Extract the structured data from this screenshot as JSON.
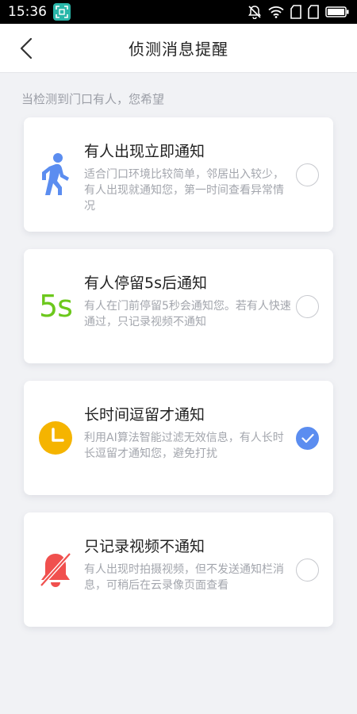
{
  "status_bar": {
    "time": "15:36"
  },
  "nav": {
    "title": "侦测消息提醒"
  },
  "section_hint": "当检测到门口有人，您希望",
  "options": [
    {
      "title": "有人出现立即通知",
      "description": "适合门口环境比较简单，邻居出入较少，有人出现就通知您，第一时间查看异常情况",
      "icon": "walking-person-icon",
      "selected": false
    },
    {
      "title": "有人停留5s后通知",
      "description": "有人在门前停留5秒会通知您。若有人快速通过，只记录视频不通知",
      "icon_text": "5s",
      "selected": false
    },
    {
      "title": "长时间逗留才通知",
      "description": "利用AI算法智能过滤无效信息，有人长时长逗留才通知您，避免打扰",
      "icon": "clock-icon",
      "selected": true
    },
    {
      "title": "只记录视频不通知",
      "description": "有人出现时拍摄视频，但不发送通知栏消息，可稍后在云录像页面查看",
      "icon": "bell-off-icon",
      "selected": false
    }
  ],
  "colors": {
    "accent": "#5b8df0",
    "walk_icon": "#5b8df0",
    "five_sec": "#6cc81c",
    "clock": "#f5b400",
    "bell_off": "#f0504e"
  }
}
